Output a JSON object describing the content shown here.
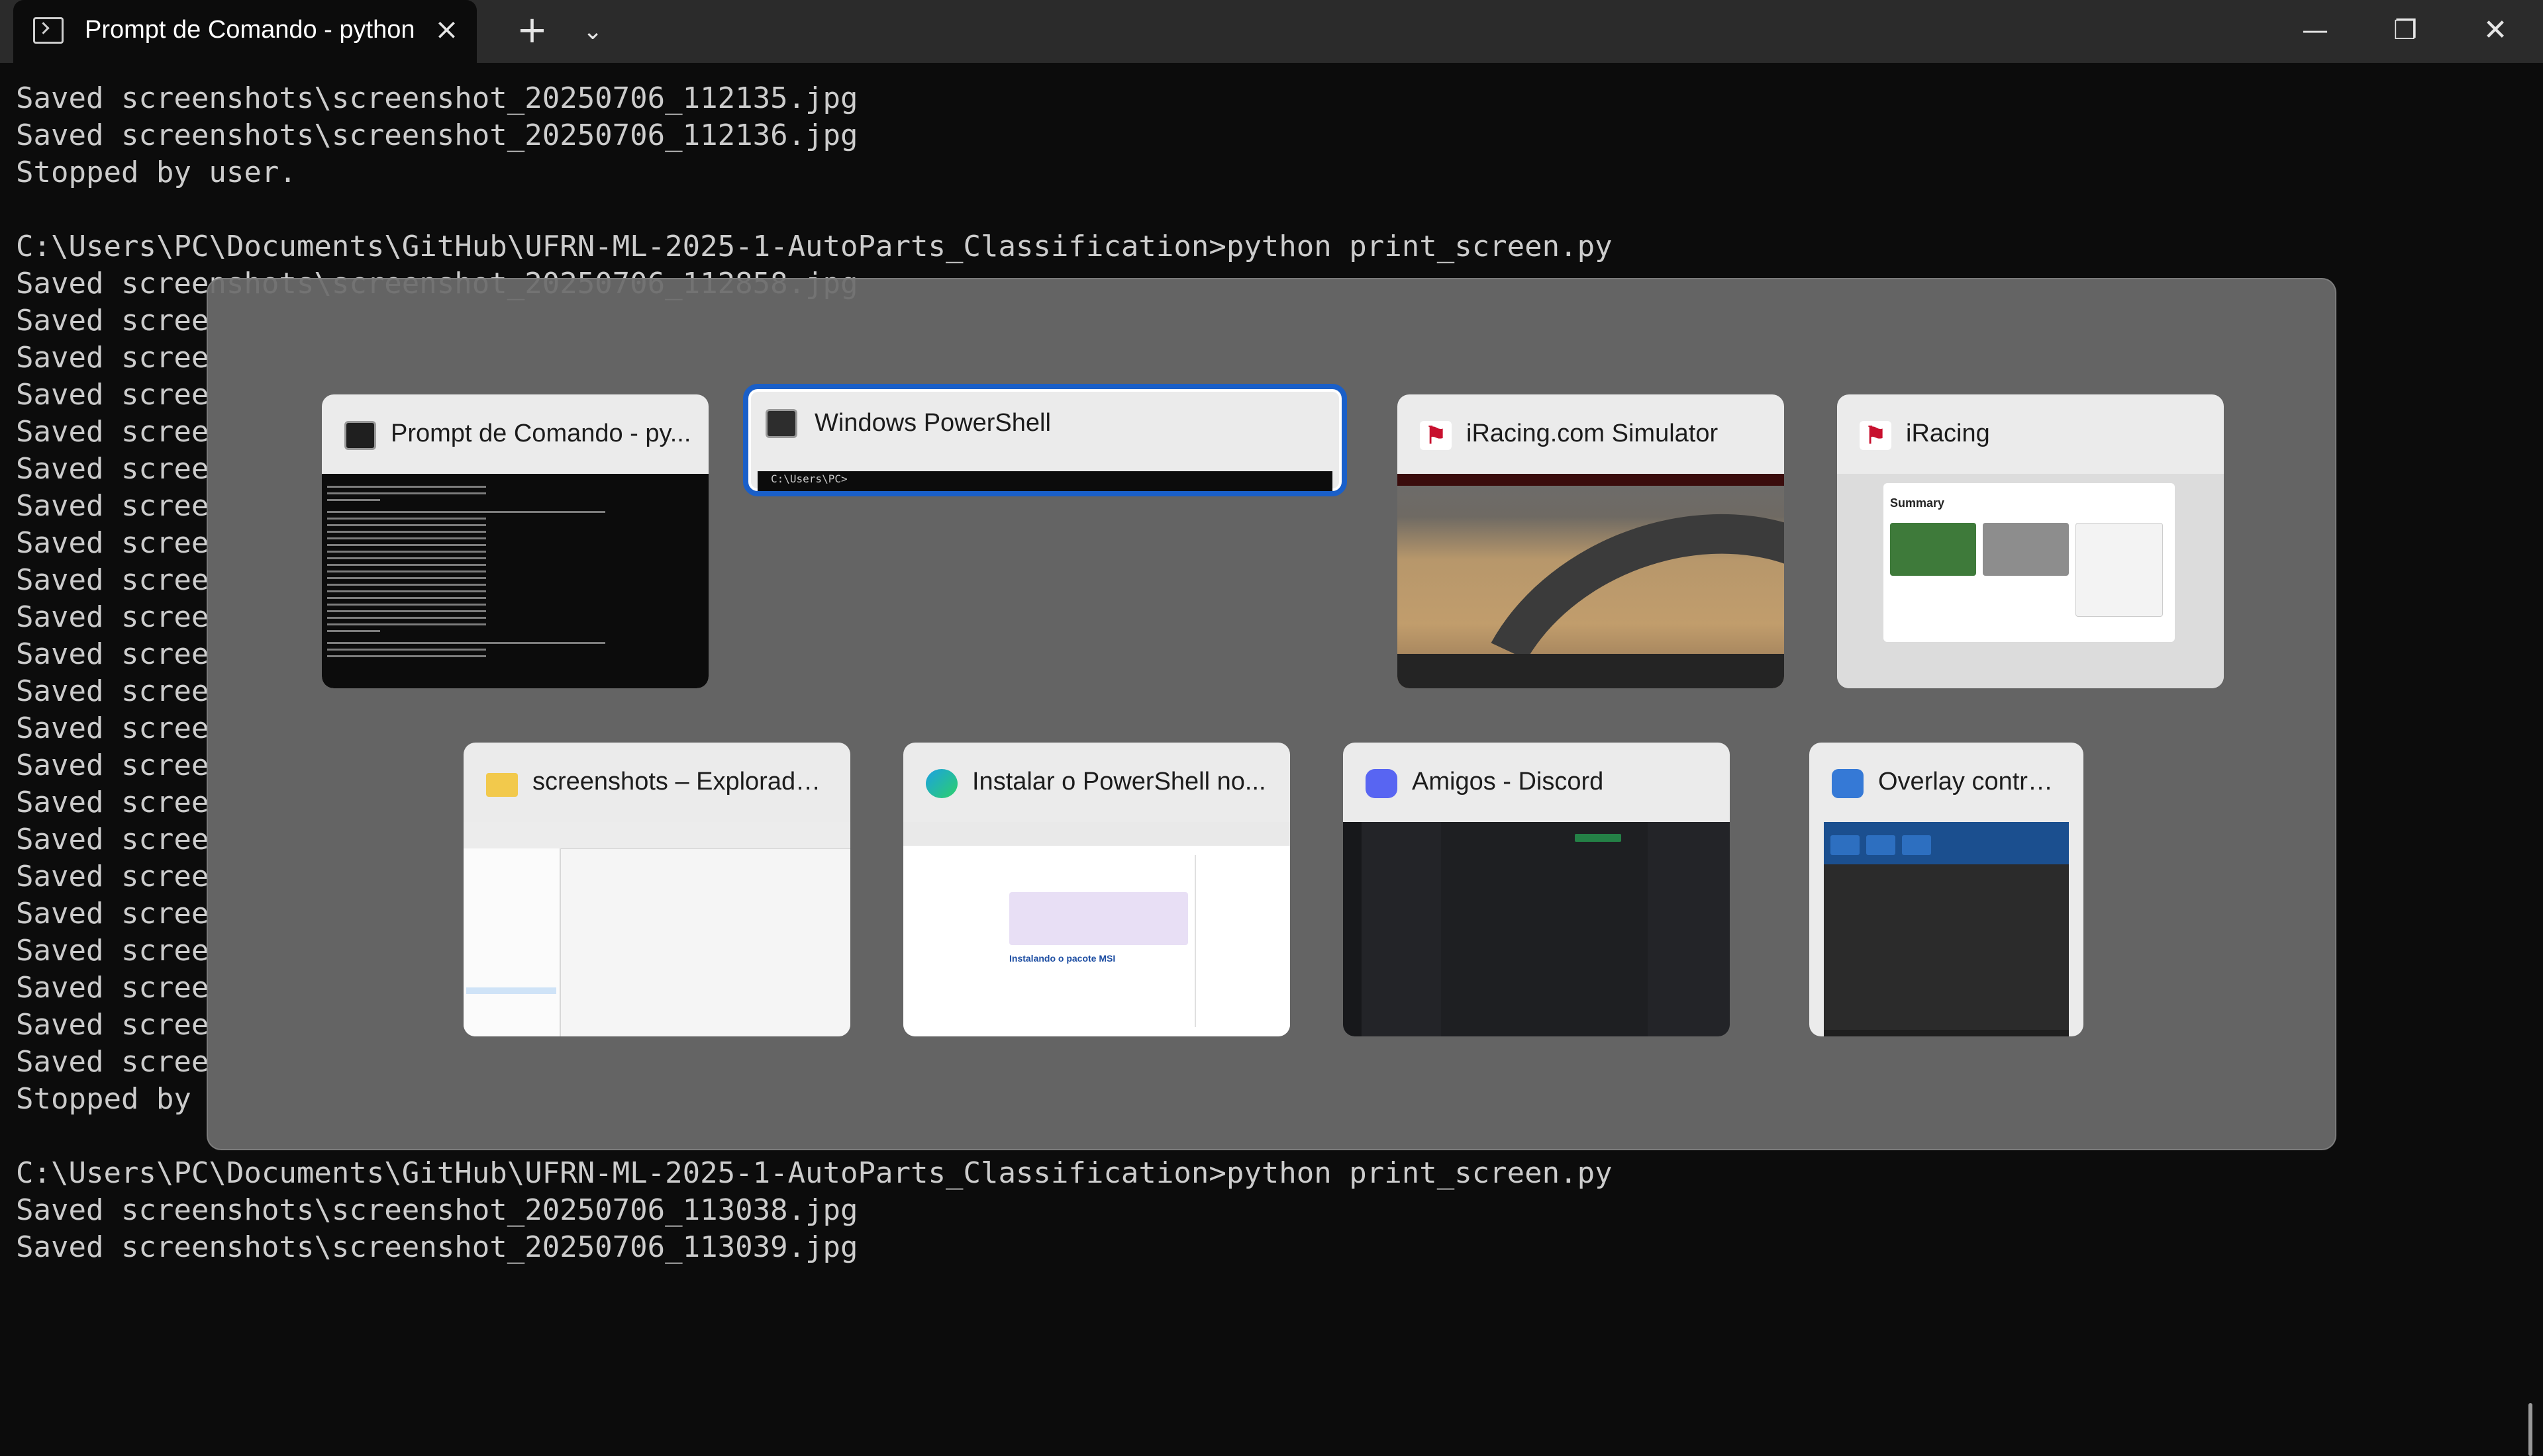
{
  "window": {
    "tab_title": "Prompt de Comando - python",
    "tab_close_icon": "×",
    "new_tab_icon": "+",
    "dropdown_icon": "⌄",
    "minimize_icon": "—",
    "maximize_icon": "❐",
    "close_icon": "✕"
  },
  "terminal": {
    "lines": [
      "Saved screenshots\\screenshot_20250706_112135.jpg",
      "Saved screenshots\\screenshot_20250706_112136.jpg",
      "Stopped by user.",
      "",
      "C:\\Users\\PC\\Documents\\GitHub\\UFRN-ML-2025-1-AutoParts_Classification>python print_screen.py",
      "Saved screenshots\\screenshot_20250706_112858.jpg",
      "Saved scree",
      "Saved scree",
      "Saved scree",
      "Saved scree",
      "Saved scree",
      "Saved scree",
      "Saved scree",
      "Saved scree",
      "Saved scree",
      "Saved scree",
      "Saved scree",
      "Saved scree",
      "Saved scree",
      "Saved scree",
      "Saved scree",
      "Saved scree",
      "Saved scree",
      "Saved scree",
      "Saved scree",
      "Saved scree",
      "Saved scree",
      "Stopped by",
      "",
      "C:\\Users\\PC\\Documents\\GitHub\\UFRN-ML-2025-1-AutoParts_Classification>python print_screen.py",
      "Saved screenshots\\screenshot_20250706_113038.jpg",
      "Saved screenshots\\screenshot_20250706_113039.jpg"
    ]
  },
  "switcher": {
    "cards": [
      {
        "title": "Prompt de Comando - py...",
        "icon": "cmd-icon"
      },
      {
        "title": "Windows PowerShell",
        "icon": "powershell-icon",
        "selected": true,
        "thumb_text": "C:\\Users\\PC>"
      },
      {
        "title": "iRacing.com Simulator",
        "icon": "iracing-icon"
      },
      {
        "title": "iRacing",
        "icon": "iracing-icon",
        "thumb_heading": "Summary"
      },
      {
        "title": "screenshots – Explorador...",
        "icon": "folder-icon"
      },
      {
        "title": "Instalar o PowerShell no...",
        "icon": "edge-icon",
        "thumb_heading": "Instalando o pacote MSI"
      },
      {
        "title": "Amigos - Discord",
        "icon": "discord-icon"
      },
      {
        "title": "Overlay control...",
        "icon": "overlay-icon"
      }
    ]
  },
  "colors": {
    "terminal_bg": "#0c0c0c",
    "terminal_text": "#cccccc",
    "titlebar_bg": "#2b2b2b",
    "selection_border": "#1a5fc8"
  }
}
